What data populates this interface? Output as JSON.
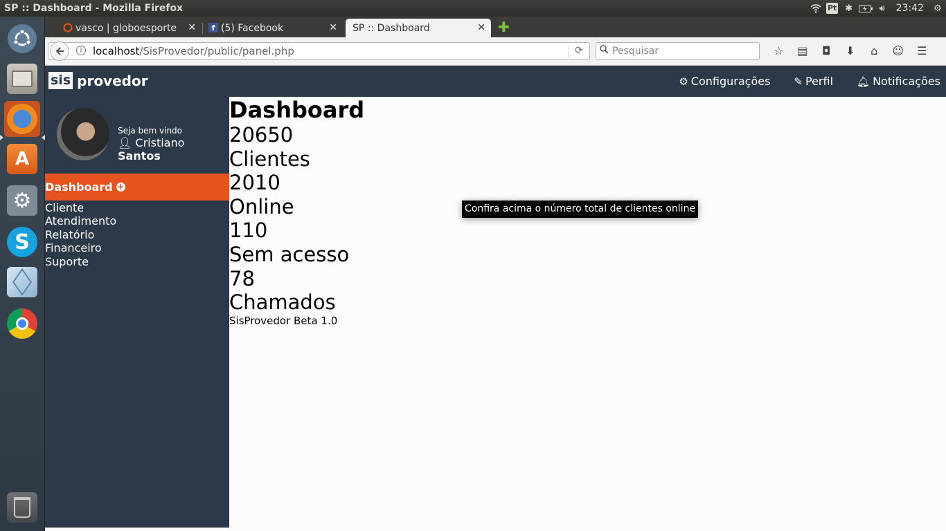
{
  "os": {
    "window_title": "SP :: Dashboard - Mozilla Firefox",
    "tray": {
      "pt_label": "Pt",
      "clock": "23:42"
    },
    "launcher_icons": [
      "ubuntu-icon",
      "files-icon",
      "firefox-icon",
      "software-center-icon",
      "settings-icon",
      "skype-icon",
      "virtualbox-icon",
      "chrome-icon",
      "trash-icon"
    ]
  },
  "browser": {
    "tabs": [
      {
        "label": "vasco | globoesporte"
      },
      {
        "label": "(5) Facebook"
      },
      {
        "label": "SP :: Dashboard"
      }
    ],
    "url_host": "localhost",
    "url_path": "/SisProvedor/public/panel.php",
    "search_placeholder": "Pesquisar"
  },
  "app": {
    "logo_box": "sis",
    "logo_name": "provedor",
    "menu": {
      "settings": "Configurações",
      "profile": "Perfil",
      "notifications": "Notificações"
    },
    "sidebar": {
      "welcome": "Seja bem vindo",
      "first_name": "Cristiano",
      "last_name": "Santos",
      "active_item": "Dashboard",
      "items": [
        "Cliente",
        "Atendimento",
        "Relatório",
        "Financeiro",
        "Suporte"
      ]
    },
    "content": {
      "title": "Dashboard",
      "stats": [
        {
          "value": "20650",
          "label": "Clientes"
        },
        {
          "value": "2010",
          "label": "Online"
        },
        {
          "value": "110",
          "label": "Sem acesso"
        },
        {
          "value": "78",
          "label": "Chamados"
        }
      ],
      "footer": "SisProvedor Beta 1.0"
    },
    "tooltip": "Confira acima o número total de clientes online"
  }
}
